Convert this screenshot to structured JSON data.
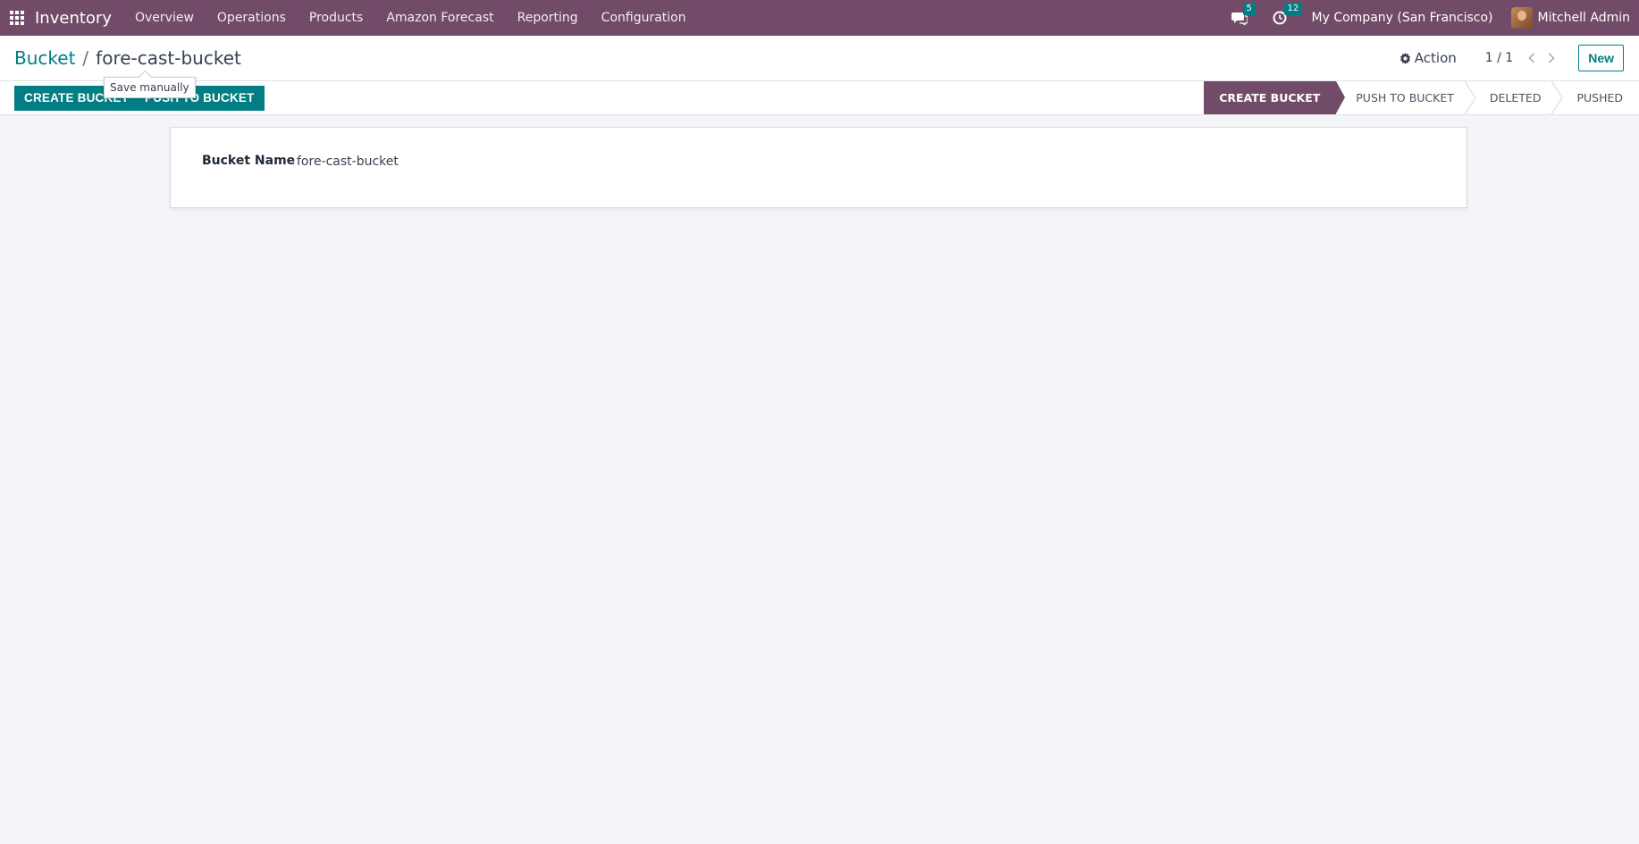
{
  "navbar": {
    "app_name": "Inventory",
    "menu": [
      "Overview",
      "Operations",
      "Products",
      "Amazon Forecast",
      "Reporting",
      "Configuration"
    ],
    "messages_count": "5",
    "activities_count": "12",
    "company": "My Company (San Francisco)",
    "user": "Mitchell Admin"
  },
  "control_panel": {
    "breadcrumb_parent": "Bucket",
    "breadcrumb_separator": "/",
    "breadcrumb_current": "fore-cast-bucket",
    "action_label": "Action",
    "pager": "1 / 1",
    "new_label": "New"
  },
  "statusbar": {
    "create_bucket_label": "CREATE BUCKET",
    "push_to_bucket_label": "PUSH TO BUCKET",
    "tooltip": "Save manually",
    "stages": [
      "CREATE BUCKET",
      "PUSH TO BUCKET",
      "DELETED",
      "PUSHED"
    ],
    "active_stage": "CREATE BUCKET"
  },
  "form": {
    "bucket_name_label": "Bucket Name",
    "bucket_name_value": "fore-cast-bucket"
  },
  "colors": {
    "brand": "#714b67",
    "accent": "#017e84"
  }
}
